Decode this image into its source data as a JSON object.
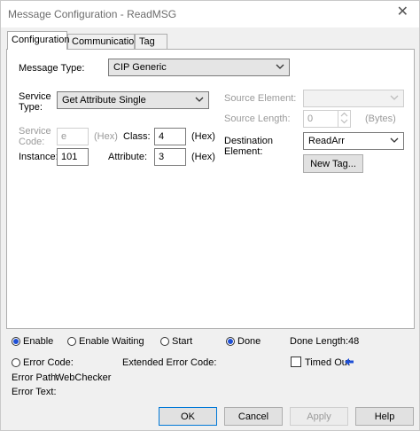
{
  "window": {
    "title": "Message Configuration - ReadMSG",
    "close_glyph": "✕"
  },
  "tabs": [
    {
      "label": "Configuration",
      "active": true
    },
    {
      "label": "Communication",
      "active": false
    },
    {
      "label": "Tag",
      "active": false
    }
  ],
  "config": {
    "message_type_label": "Message Type:",
    "message_type_value": "CIP Generic",
    "service_type_label_1": "Service",
    "service_type_label_2": "Type:",
    "service_type_value": "Get Attribute Single",
    "service_code_label_1": "Service",
    "service_code_label_2": "Code:",
    "service_code_value": "e",
    "service_code_unit": "(Hex)",
    "class_label": "Class:",
    "class_value": "4",
    "class_unit": "(Hex)",
    "instance_label": "Instance:",
    "instance_value": "101",
    "attribute_label": "Attribute:",
    "attribute_value": "3",
    "attribute_unit": "(Hex)",
    "source_element_label": "Source Element:",
    "source_length_label": "Source Length:",
    "source_length_value": "0",
    "source_length_unit": "(Bytes)",
    "destination_label_1": "Destination",
    "destination_label_2": "Element:",
    "destination_value": "ReadArr",
    "new_tag_label": "New Tag..."
  },
  "status": {
    "enable_label": "Enable",
    "enable_waiting_label": "Enable Waiting",
    "start_label": "Start",
    "done_label": "Done",
    "done_length_label": "Done Length:",
    "done_length_value": "48",
    "error_code_label": "Error Code:",
    "extended_error_label": "Extended Error Code:",
    "timed_out_label": "Timed Out",
    "error_path_label": "Error Path:",
    "error_path_value": "WebChecker",
    "error_text_label": "Error Text:"
  },
  "buttons": {
    "ok": "OK",
    "cancel": "Cancel",
    "apply": "Apply",
    "help": "Help"
  },
  "colors": {
    "radio_selected": "#1e4fd6",
    "arrow": "#1e4fd6",
    "focus_border": "#0078d7"
  },
  "icons": {
    "dropdown": "chevron-down-icon",
    "timed_out_indicator": "arrow-left-icon"
  }
}
